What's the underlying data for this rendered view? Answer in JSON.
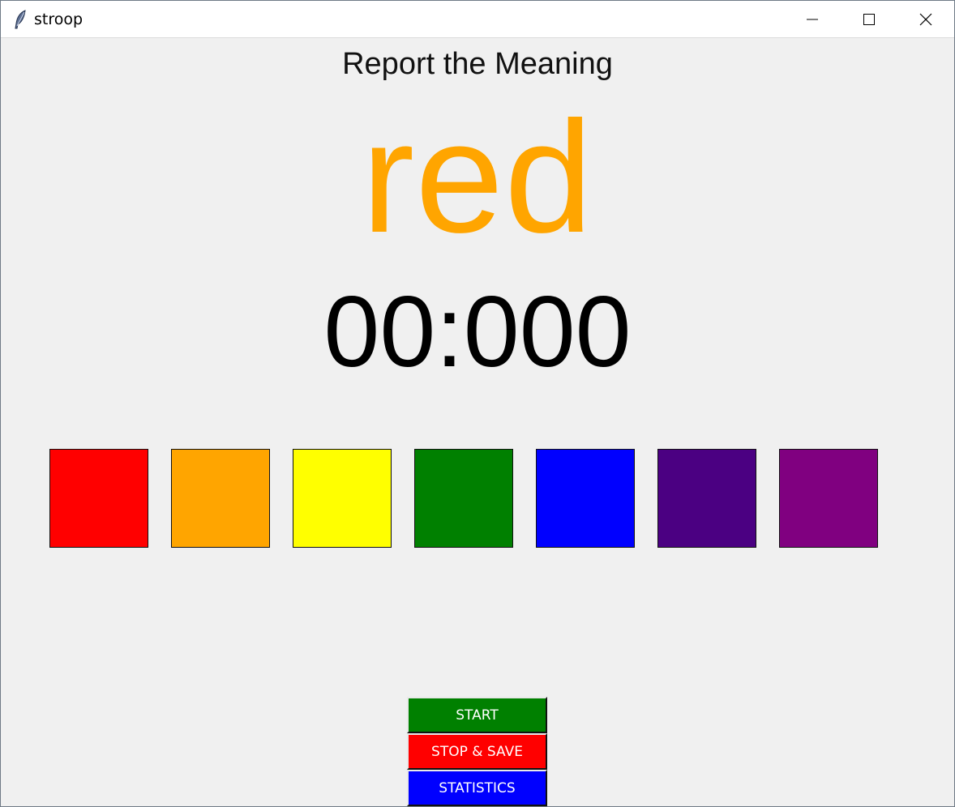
{
  "window": {
    "title": "stroop",
    "icon": "feather-icon",
    "controls": [
      "minimize-icon",
      "maximize-icon",
      "close-icon"
    ]
  },
  "main": {
    "instruction": "Report the Meaning",
    "stimulus_word": "red",
    "stimulus_color": "#ffa500",
    "timer": "00:000"
  },
  "swatches": [
    {
      "name": "red",
      "color": "#ff0000"
    },
    {
      "name": "orange",
      "color": "#ffa500"
    },
    {
      "name": "yellow",
      "color": "#ffff00"
    },
    {
      "name": "green",
      "color": "#008000"
    },
    {
      "name": "blue",
      "color": "#0000ff"
    },
    {
      "name": "indigo",
      "color": "#4b0082"
    },
    {
      "name": "purple",
      "color": "#800080"
    }
  ],
  "controls": {
    "start": {
      "label": "START",
      "color": "#008000"
    },
    "stop_save": {
      "label": "STOP & SAVE",
      "color": "#ff0000"
    },
    "statistics": {
      "label": "STATISTICS",
      "color": "#0000ff"
    }
  }
}
